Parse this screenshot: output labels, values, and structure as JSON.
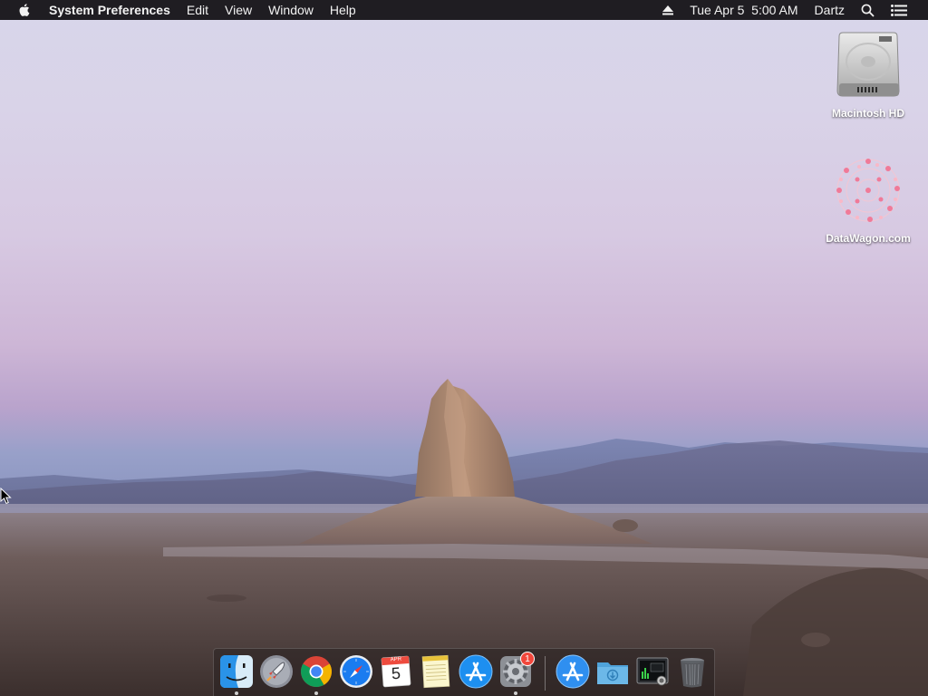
{
  "menubar": {
    "app_name": "System Preferences",
    "menus": [
      "Edit",
      "View",
      "Window",
      "Help"
    ],
    "date_time": "Tue Apr 5  5:00 AM",
    "user": "Dartz",
    "icons": [
      "apple-logo-icon",
      "eject-icon",
      "spotlight-search-icon",
      "notification-center-icon"
    ]
  },
  "desktop_icons": [
    {
      "label": "Macintosh HD",
      "icon": "hard-drive-icon"
    },
    {
      "label": "DataWagon.com",
      "icon": "datawagon-network-icon"
    }
  ],
  "dock": {
    "apps": [
      {
        "name": "finder",
        "icon": "finder-icon",
        "running": true
      },
      {
        "name": "launchpad",
        "icon": "launchpad-icon",
        "running": false
      },
      {
        "name": "chrome",
        "icon": "chrome-icon",
        "running": true
      },
      {
        "name": "safari",
        "icon": "safari-icon",
        "running": false
      },
      {
        "name": "calendar",
        "icon": "calendar-icon",
        "running": false
      },
      {
        "name": "notes",
        "icon": "notes-icon",
        "running": false
      },
      {
        "name": "app-store",
        "icon": "app-store-icon",
        "running": false
      },
      {
        "name": "system-preferences",
        "icon": "system-preferences-icon",
        "running": true
      }
    ],
    "others": [
      {
        "name": "applications-folder",
        "icon": "applications-folder-icon"
      },
      {
        "name": "downloads-folder",
        "icon": "downloads-folder-icon"
      },
      {
        "name": "activity-monitor",
        "icon": "activity-monitor-icon"
      },
      {
        "name": "trash",
        "icon": "trash-icon"
      }
    ],
    "calendar_month": "APR",
    "calendar_day": "5",
    "system_preferences_badge": "1"
  },
  "colors": {
    "menubar_bg": "#1f1d22",
    "badge_red": "#f2473c",
    "safari_blue": "#1a7cf0",
    "appstore_blue": "#1d8ff0"
  }
}
